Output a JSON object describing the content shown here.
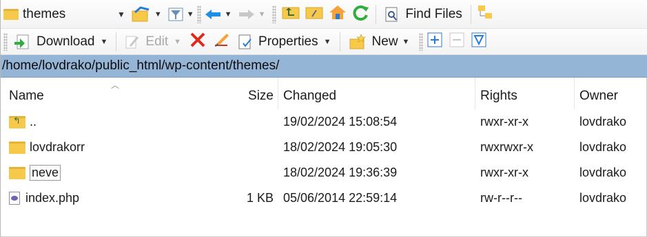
{
  "toolbar1": {
    "location_combo_value": "themes",
    "find_files_label": "Find Files"
  },
  "toolbar2": {
    "download_label": "Download",
    "edit_label": "Edit",
    "properties_label": "Properties",
    "new_label": "New"
  },
  "address_bar": {
    "path": "/home/lovdrako/public_html/wp-content/themes/"
  },
  "file_list": {
    "columns": {
      "name": "Name",
      "size": "Size",
      "changed": "Changed",
      "rights": "Rights",
      "owner": "Owner"
    },
    "rows": [
      {
        "name": "..",
        "size": "",
        "changed": "19/02/2024 15:08:54",
        "rights": "rwxr-xr-x",
        "owner": "lovdrako",
        "icon": "parent-folder-icon"
      },
      {
        "name": "lovdrakorr",
        "size": "",
        "changed": "18/02/2024 19:05:30",
        "rights": "rwxrwxr-x",
        "owner": "lovdrako",
        "icon": "folder-icon"
      },
      {
        "name": "neve",
        "size": "",
        "changed": "18/02/2024 19:36:39",
        "rights": "rwxr-xr-x",
        "owner": "lovdrako",
        "icon": "folder-icon"
      },
      {
        "name": "index.php",
        "size": "1 KB",
        "changed": "05/06/2014 22:59:14",
        "rights": "rw-r--r--",
        "owner": "lovdrako",
        "icon": "php-file-icon"
      }
    ]
  },
  "colors": {
    "address_bar_bg": "#95b5d6",
    "folder_yellow": "#f6c94a",
    "delete_red": "#e0281c",
    "nav_blue": "#1e8fe6"
  }
}
